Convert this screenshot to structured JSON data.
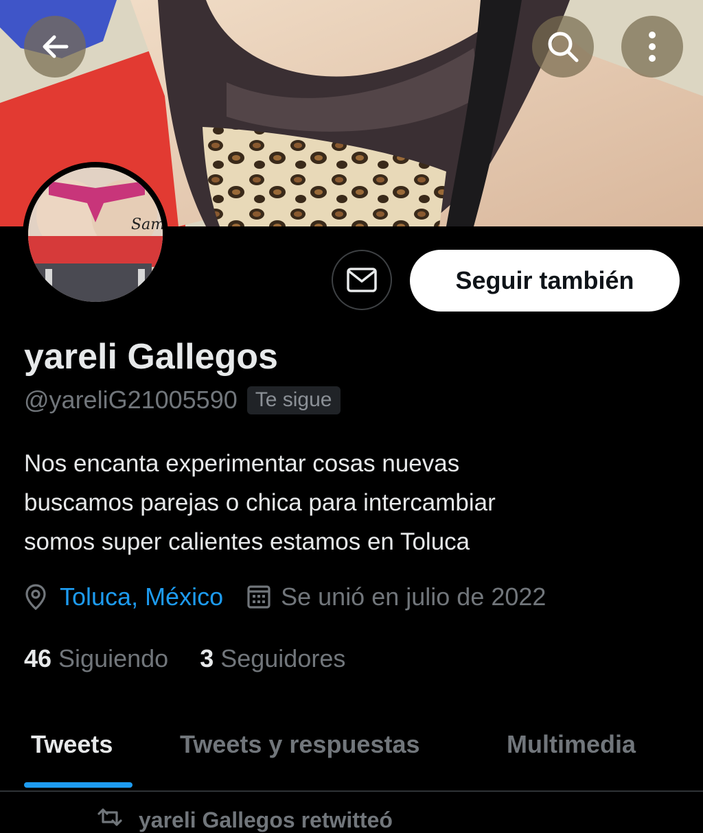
{
  "header": {
    "back_icon": "arrow-left-icon",
    "search_icon": "search-icon",
    "more_icon": "more-vertical-icon"
  },
  "profile": {
    "display_name": "yareli Gallegos",
    "handle": "@yareliG21005590",
    "follows_you_badge": "Te sigue",
    "avatar_watermark": "Sam",
    "bio_lines": [
      "Nos encanta experimentar cosas nuevas",
      "buscamos parejas o chica para intercambiar",
      "somos super calientes estamos en Toluca"
    ],
    "location": "Toluca, México",
    "joined": "Se unió en julio de 2022",
    "following_count": "46",
    "following_label": "Siguiendo",
    "followers_count": "3",
    "followers_label": "Seguidores"
  },
  "actions": {
    "message_icon": "mail-icon",
    "follow_label": "Seguir también"
  },
  "tabs": [
    {
      "label": "Tweets",
      "active": true
    },
    {
      "label": "Tweets y respuestas",
      "active": false
    },
    {
      "label": "Multimedia",
      "active": false
    }
  ],
  "timeline": {
    "retweet_label": "yareli Gallegos retwitteó"
  },
  "colors": {
    "background": "#000000",
    "accent": "#1d9bf0",
    "text_primary": "#e7e9ea",
    "text_secondary": "#71767b",
    "button_bg": "#ffffff"
  }
}
